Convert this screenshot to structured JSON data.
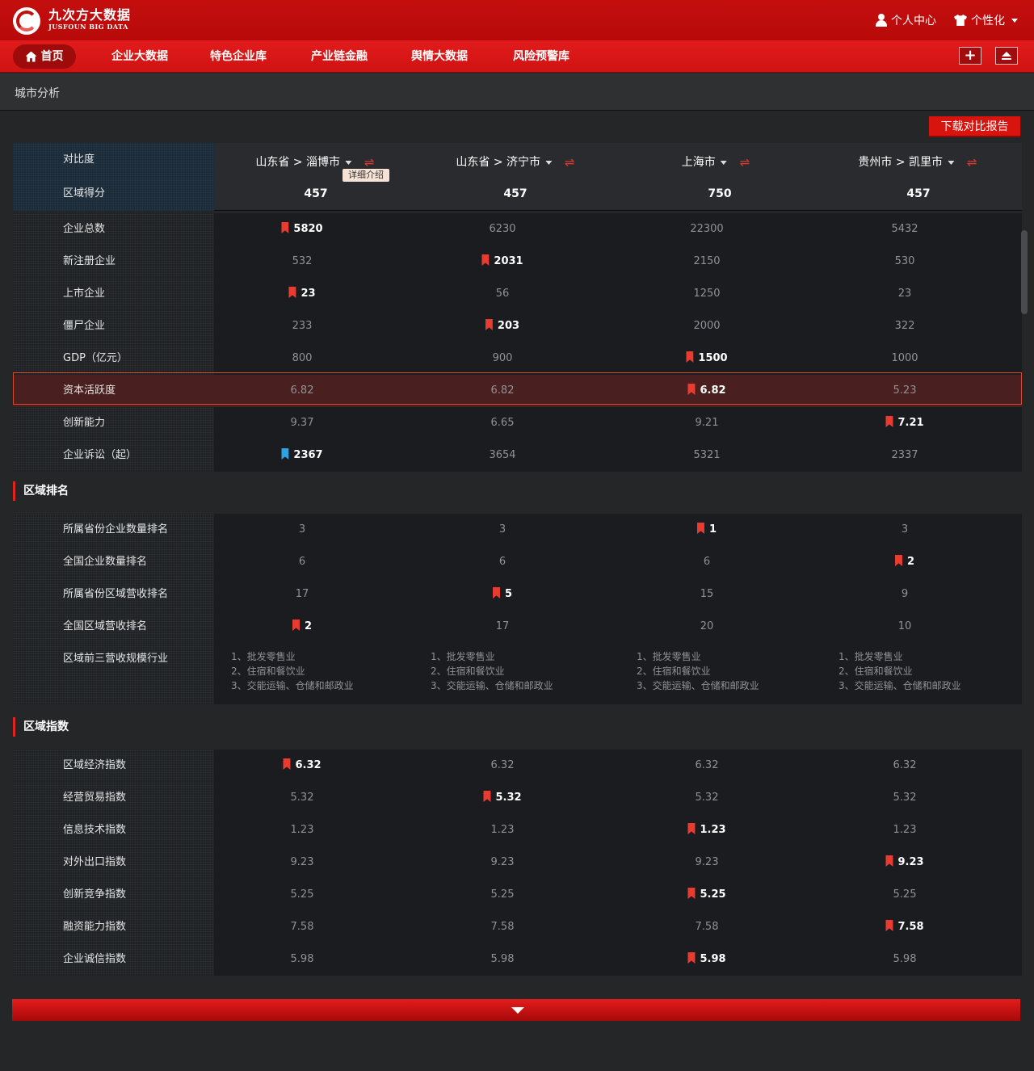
{
  "brand": {
    "name_cn": "九次方大数据",
    "name_en": "JUSFOUN BIG DATA"
  },
  "user_links": {
    "personal": "个人中心",
    "customize": "个性化"
  },
  "nav": {
    "home": "首页",
    "items": [
      "企业大数据",
      "特色企业库",
      "产业链金融",
      "舆情大数据",
      "风险预警库"
    ]
  },
  "breadcrumb": "城市分析",
  "download_label": "下载对比报告",
  "tooltip": "详细介绍",
  "header": {
    "label": "对比度",
    "score_label": "区域得分",
    "regions": [
      "山东省 > 淄博市",
      "山东省 > 济宁市",
      "上海市",
      "贵州市 > 凯里市"
    ],
    "scores": [
      "457",
      "457",
      "750",
      "457"
    ]
  },
  "basic": [
    {
      "label": "企业总数",
      "values": [
        "5820",
        "6230",
        "22300",
        "5432"
      ],
      "best": 0
    },
    {
      "label": "新注册企业",
      "values": [
        "532",
        "2031",
        "2150",
        "530"
      ],
      "best": 1
    },
    {
      "label": "上市企业",
      "values": [
        "23",
        "56",
        "1250",
        "23"
      ],
      "best": 0
    },
    {
      "label": "僵尸企业",
      "values": [
        "233",
        "203",
        "2000",
        "322"
      ],
      "best": 1
    },
    {
      "label": "GDP（亿元）",
      "values": [
        "800",
        "900",
        "1500",
        "1000"
      ],
      "best": 2
    },
    {
      "label": "资本活跃度",
      "values": [
        "6.82",
        "6.82",
        "6.82",
        "5.23"
      ],
      "best": 2,
      "selected": true
    },
    {
      "label": "创新能力",
      "values": [
        "9.37",
        "6.65",
        "9.21",
        "7.21"
      ],
      "best": 3
    },
    {
      "label": "企业诉讼（起）",
      "values": [
        "2367",
        "3654",
        "5321",
        "2337"
      ],
      "best": 0,
      "blue": true
    }
  ],
  "ranking_title": "区域排名",
  "ranking": [
    {
      "label": "所属省份企业数量排名",
      "values": [
        "3",
        "3",
        "1",
        "3"
      ],
      "best": 2
    },
    {
      "label": "全国企业数量排名",
      "values": [
        "6",
        "6",
        "6",
        "2"
      ],
      "best": 3
    },
    {
      "label": "所属省份区域营收排名",
      "values": [
        "17",
        "5",
        "15",
        "9"
      ],
      "best": 1
    },
    {
      "label": "全国区域营收排名",
      "values": [
        "2",
        "17",
        "20",
        "10"
      ],
      "best": 0
    }
  ],
  "top3_label": "区域前三营收规模行业",
  "top3": [
    "1、批发零售业",
    "2、住宿和餐饮业",
    "3、交能运输、仓储和邮政业"
  ],
  "index_title": "区域指数",
  "index": [
    {
      "label": "区域经济指数",
      "values": [
        "6.32",
        "6.32",
        "6.32",
        "6.32"
      ],
      "best": 0
    },
    {
      "label": "经营贸易指数",
      "values": [
        "5.32",
        "5.32",
        "5.32",
        "5.32"
      ],
      "best": 1
    },
    {
      "label": "信息技术指数",
      "values": [
        "1.23",
        "1.23",
        "1.23",
        "1.23"
      ],
      "best": 2
    },
    {
      "label": "对外出口指数",
      "values": [
        "9.23",
        "9.23",
        "9.23",
        "9.23"
      ],
      "best": 3
    },
    {
      "label": "创新竞争指数",
      "values": [
        "5.25",
        "5.25",
        "5.25",
        "5.25"
      ],
      "best": 2
    },
    {
      "label": "融资能力指数",
      "values": [
        "7.58",
        "7.58",
        "7.58",
        "7.58"
      ],
      "best": 3
    },
    {
      "label": "企业诚信指数",
      "values": [
        "5.98",
        "5.98",
        "5.98",
        "5.98"
      ],
      "best": 2
    }
  ]
}
